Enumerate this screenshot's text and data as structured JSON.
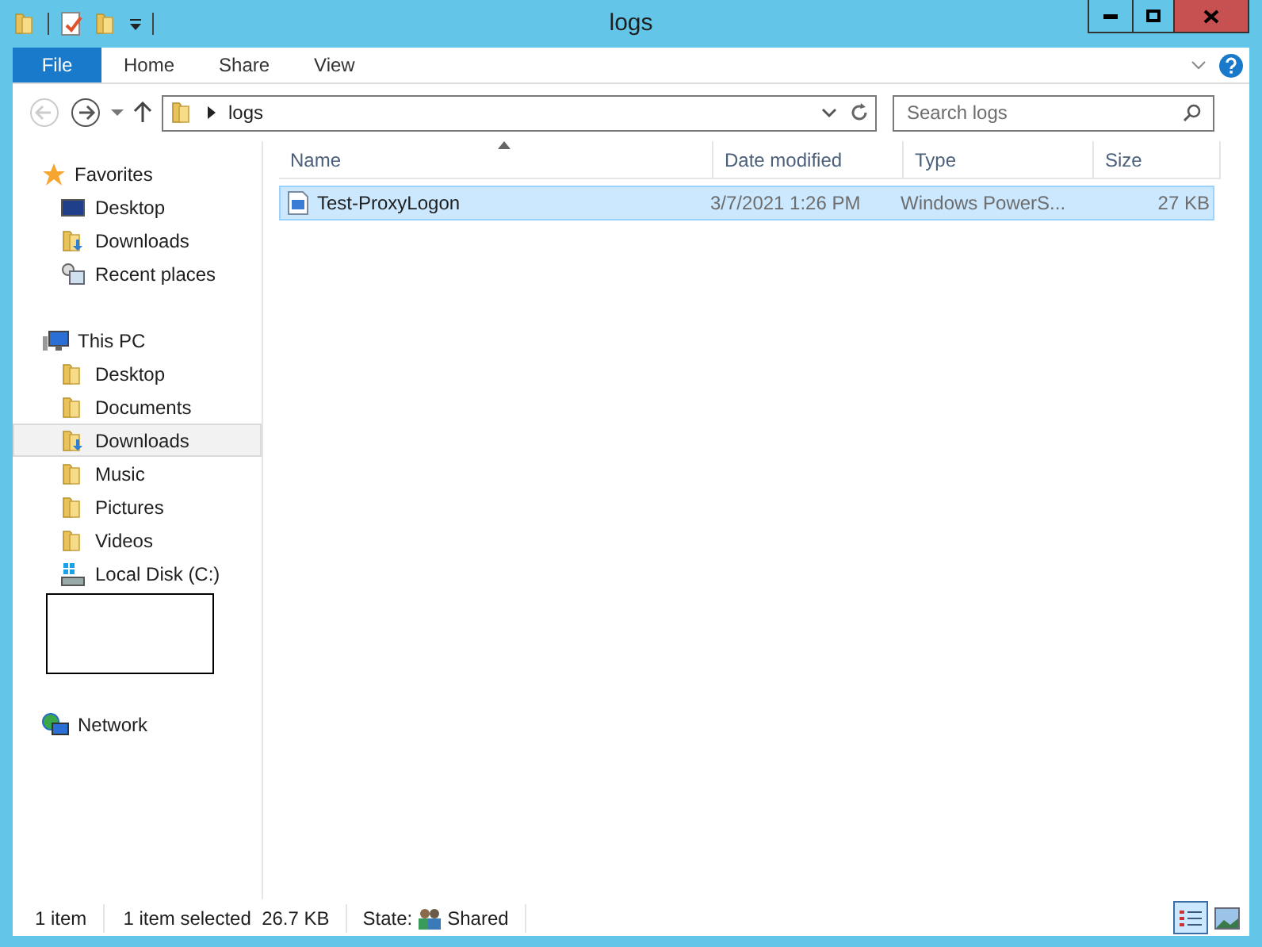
{
  "window": {
    "title": "logs"
  },
  "ribbon_tabs": [
    {
      "label": "File",
      "selected": true
    },
    {
      "label": "Home",
      "selected": false
    },
    {
      "label": "Share",
      "selected": false
    },
    {
      "label": "View",
      "selected": false
    }
  ],
  "address": {
    "path": "logs"
  },
  "search": {
    "placeholder": "Search logs"
  },
  "sidebar": [
    {
      "label": "Favorites",
      "kind": "star",
      "children": [
        {
          "label": "Desktop",
          "kind": "desktop",
          "selected": false
        },
        {
          "label": "Downloads",
          "kind": "downloads",
          "selected": false
        },
        {
          "label": "Recent places",
          "kind": "recent",
          "selected": false
        }
      ]
    },
    {
      "label": "This PC",
      "kind": "pc",
      "children": [
        {
          "label": "Desktop",
          "kind": "folder",
          "selected": false
        },
        {
          "label": "Documents",
          "kind": "folder",
          "selected": false
        },
        {
          "label": "Downloads",
          "kind": "downloads",
          "selected": true
        },
        {
          "label": "Music",
          "kind": "folder",
          "selected": false
        },
        {
          "label": "Pictures",
          "kind": "folder",
          "selected": false
        },
        {
          "label": "Videos",
          "kind": "folder",
          "selected": false
        },
        {
          "label": "Local Disk (C:)",
          "kind": "disk",
          "selected": false
        }
      ]
    },
    {
      "label": "Network",
      "kind": "network"
    }
  ],
  "table": {
    "columns": [
      "Name",
      "Date modified",
      "Type",
      "Size"
    ],
    "rows": [
      {
        "name": "Test-ProxyLogon",
        "date": "3/7/2021 1:26 PM",
        "type": "Windows PowerS...",
        "size": "27 KB",
        "selected": true
      }
    ]
  },
  "status_bar": {
    "count": "1 item",
    "selection": "1 item selected  26.7 KB",
    "state_label": "State:",
    "state": "Shared"
  }
}
